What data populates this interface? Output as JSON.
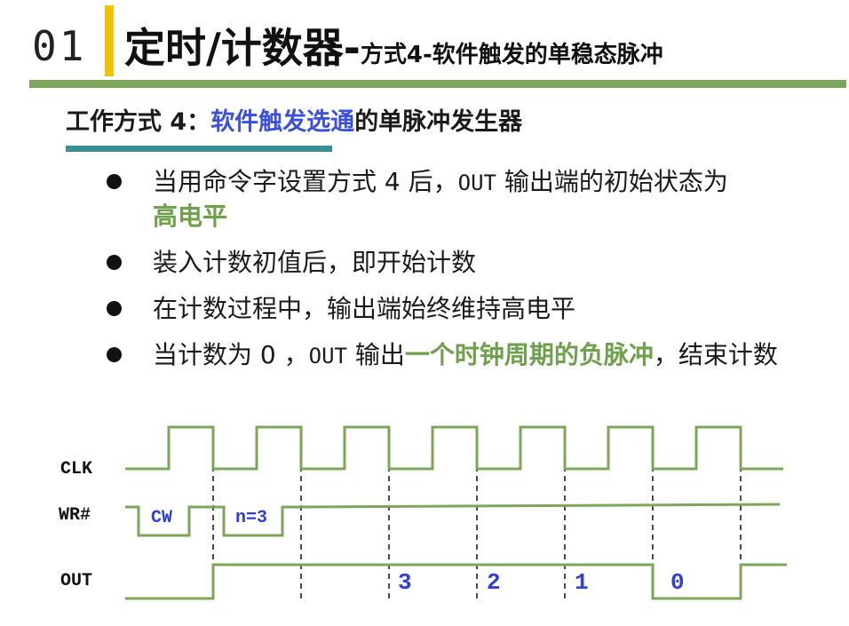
{
  "header": {
    "number": "01",
    "title_main": "定时/计数器-",
    "title_sub": "方式4-软件触发的单稳态脉冲"
  },
  "subtitle": {
    "prefix": "工作方式 4：",
    "highlight": "软件触发选通",
    "suffix": "的单脉冲发生器"
  },
  "bullets": [
    {
      "parts": [
        "当用命令字设置方式 4 后，",
        "OUT",
        " 输出端的初始状态为",
        "高电平"
      ]
    },
    {
      "text": "装入计数初值后，即开始计数"
    },
    {
      "text": "在计数过程中，输出端始终维持高电平"
    },
    {
      "parts": [
        "当计数为 0 ，",
        "OUT",
        " 输出",
        "一个时钟周期的负脉冲",
        "，结束计数"
      ]
    }
  ],
  "diagram": {
    "signals": [
      "CLK",
      "WR#",
      "OUT"
    ],
    "wr_labels": [
      "CW",
      "n=3"
    ],
    "count_labels": [
      "3",
      "2",
      "1",
      "0"
    ],
    "colors": {
      "wave": "#7ea65a",
      "label": "#2f3fd8",
      "signal": "#111111"
    }
  }
}
